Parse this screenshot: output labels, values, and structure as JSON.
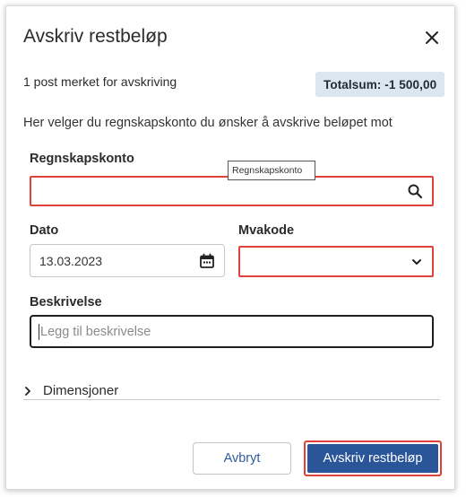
{
  "dialog": {
    "title": "Avskriv restbeløp",
    "close_icon": "close-icon",
    "summary_text": "1 post merket for avskriving",
    "total_badge": "Totalsum: -1 500,00",
    "description": "Her velger du regnskapskonto du ønsker å avskrive beløpet mot"
  },
  "form": {
    "account": {
      "label": "Regnskapskonto",
      "value": "",
      "tooltip": "Regnskapskonto",
      "icon": "search-icon"
    },
    "date": {
      "label": "Dato",
      "value": "13.03.2023",
      "icon": "calendar-icon"
    },
    "vat": {
      "label": "Mvakode",
      "value": "",
      "icon": "chevron-down-icon"
    },
    "description": {
      "label": "Beskrivelse",
      "placeholder": "Legg til beskrivelse"
    },
    "dimensions": {
      "label": "Dimensjoner",
      "icon": "chevron-right-icon"
    }
  },
  "footer": {
    "cancel_label": "Avbryt",
    "submit_label": "Avskriv restbeløp"
  },
  "colors": {
    "primary": "#2a5699",
    "highlight": "#e0413a",
    "badge_bg": "#dbe6ef"
  }
}
